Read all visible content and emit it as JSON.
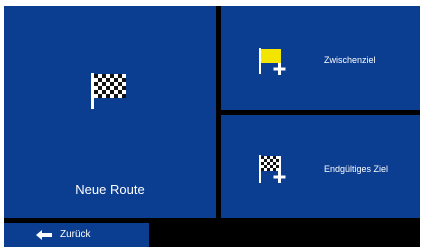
{
  "menu": {
    "new_route": {
      "label": "Neue Route",
      "icon": "checkered-flag-icon"
    },
    "waypoint": {
      "label": "Zwischenziel",
      "icon": "yellow-flag-plus-icon"
    },
    "final_destination": {
      "label": "Endgültiges Ziel",
      "icon": "checkered-flag-plus-icon"
    }
  },
  "footer": {
    "back_label": "Zurück",
    "back_icon": "arrow-left-icon"
  },
  "colors": {
    "tile_background": "#0b3d91",
    "screen_background": "#000000",
    "text": "#ffffff",
    "waypoint_flag": "#f2e600",
    "plus_sign": "#ffffff"
  }
}
